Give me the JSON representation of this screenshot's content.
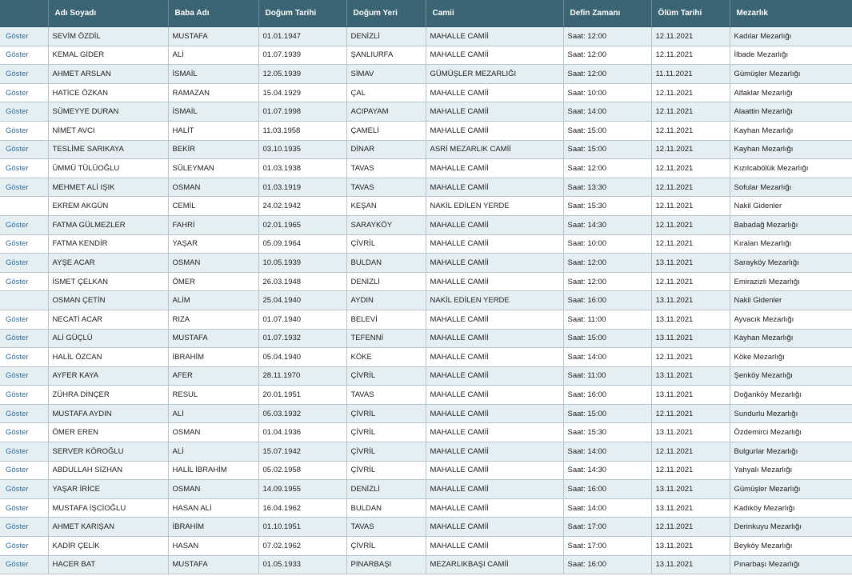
{
  "table": {
    "columns": [
      "",
      "Adı Soyadı",
      "Baba Adı",
      "Doğum Tarihi",
      "Doğum Yeri",
      "Camii",
      "Defin Zamanı",
      "Ölüm Tarihi",
      "Mezarlık"
    ],
    "rows": [
      {
        "action": "Göster",
        "name": "SEVİM ÖZDİL",
        "father": "MUSTAFA",
        "birth_date": "01.01.1947",
        "birth_place": "DENİZLİ",
        "mosque": "MAHALLE CAMİİ",
        "burial_time": "Saat: 12:00",
        "death_date": "12.11.2021",
        "cemetery": "Kadılar Mezarlığı"
      },
      {
        "action": "Göster",
        "name": "KEMAL GİDER",
        "father": "ALİ",
        "birth_date": "01.07.1939",
        "birth_place": "ŞANLIURFA",
        "mosque": "MAHALLE CAMİİ",
        "burial_time": "Saat: 12:00",
        "death_date": "12.11.2021",
        "cemetery": "İlbade Mezarlığı"
      },
      {
        "action": "Göster",
        "name": "AHMET ARSLAN",
        "father": "İSMAİL",
        "birth_date": "12.05.1939",
        "birth_place": "SİMAV",
        "mosque": "GÜMÜŞLER MEZARLIĞI",
        "burial_time": "Saat: 12:00",
        "death_date": "11.11.2021",
        "cemetery": "Gümüşler Mezarlığı"
      },
      {
        "action": "Göster",
        "name": "HATİCE ÖZKAN",
        "father": "RAMAZAN",
        "birth_date": "15.04.1929",
        "birth_place": "ÇAL",
        "mosque": "MAHALLE CAMİİ",
        "burial_time": "Saat: 10:00",
        "death_date": "12.11.2021",
        "cemetery": "Alfaklar Mezarlığı"
      },
      {
        "action": "Göster",
        "name": "SÜMEYYE DURAN",
        "father": "İSMAİL",
        "birth_date": "01.07.1998",
        "birth_place": "ACIPAYAM",
        "mosque": "MAHALLE CAMİİ",
        "burial_time": "Saat: 14:00",
        "death_date": "12.11.2021",
        "cemetery": "Alaattin Mezarlığı"
      },
      {
        "action": "Göster",
        "name": "NİMET AVCI",
        "father": "HALİT",
        "birth_date": "11.03.1958",
        "birth_place": "ÇAMELİ",
        "mosque": "MAHALLE CAMİİ",
        "burial_time": "Saat: 15:00",
        "death_date": "12.11.2021",
        "cemetery": "Kayhan Mezarlığı"
      },
      {
        "action": "Göster",
        "name": "TESLİME SARIKAYA",
        "father": "BEKİR",
        "birth_date": "03.10.1935",
        "birth_place": "DİNAR",
        "mosque": "ASRİ MEZARLIK CAMİİ",
        "burial_time": "Saat: 15:00",
        "death_date": "12.11.2021",
        "cemetery": "Kayhan Mezarlığı"
      },
      {
        "action": "Göster",
        "name": "ÜMMÜ TÜLÜOĞLU",
        "father": "SÜLEYMAN",
        "birth_date": "01.03.1938",
        "birth_place": "TAVAS",
        "mosque": "MAHALLE CAMİİ",
        "burial_time": "Saat: 12:00",
        "death_date": "12.11.2021",
        "cemetery": "Kızılcabölük Mezarlığı"
      },
      {
        "action": "Göster",
        "name": "MEHMET ALİ IŞIK",
        "father": "OSMAN",
        "birth_date": "01.03.1919",
        "birth_place": "TAVAS",
        "mosque": "MAHALLE CAMİİ",
        "burial_time": "Saat: 13:30",
        "death_date": "12.11.2021",
        "cemetery": "Sofular Mezarlığı"
      },
      {
        "action": "",
        "name": "EKREM AKGÜN",
        "father": "CEMİL",
        "birth_date": "24.02.1942",
        "birth_place": "KEŞAN",
        "mosque": "NAKİL EDİLEN YERDE",
        "burial_time": "Saat: 15:30",
        "death_date": "12.11.2021",
        "cemetery": "Nakil Gidenler"
      },
      {
        "action": "Göster",
        "name": "FATMA GÜLMEZLER",
        "father": "FAHRİ",
        "birth_date": "02.01.1965",
        "birth_place": "SARAYKÖY",
        "mosque": "MAHALLE CAMİİ",
        "burial_time": "Saat: 14:30",
        "death_date": "12.11.2021",
        "cemetery": "Babadağ Mezarlığı"
      },
      {
        "action": "Göster",
        "name": "FATMA KENDİR",
        "father": "YAŞAR",
        "birth_date": "05.09.1964",
        "birth_place": "ÇİVRİL",
        "mosque": "MAHALLE CAMİİ",
        "burial_time": "Saat: 10:00",
        "death_date": "12.11.2021",
        "cemetery": "Kıralan Mezarlığı"
      },
      {
        "action": "Göster",
        "name": "AYŞE ACAR",
        "father": "OSMAN",
        "birth_date": "10.05.1939",
        "birth_place": "BULDAN",
        "mosque": "MAHALLE CAMİİ",
        "burial_time": "Saat: 12:00",
        "death_date": "13.11.2021",
        "cemetery": "Sarayköy Mezarlığı"
      },
      {
        "action": "Göster",
        "name": "İSMET ÇELKAN",
        "father": "ÖMER",
        "birth_date": "26.03.1948",
        "birth_place": "DENİZLİ",
        "mosque": "MAHALLE CAMİİ",
        "burial_time": "Saat: 12:00",
        "death_date": "12.11.2021",
        "cemetery": "Emirazizli Mezarlığı"
      },
      {
        "action": "",
        "name": "OSMAN ÇETİN",
        "father": "ALİM",
        "birth_date": "25.04.1940",
        "birth_place": "AYDIN",
        "mosque": "NAKİL EDİLEN YERDE",
        "burial_time": "Saat: 16:00",
        "death_date": "13.11.2021",
        "cemetery": "Nakil Gidenler"
      },
      {
        "action": "Göster",
        "name": "NECATİ ACAR",
        "father": "RIZA",
        "birth_date": "01.07.1940",
        "birth_place": "BELEVİ",
        "mosque": "MAHALLE CAMİİ",
        "burial_time": "Saat: 11:00",
        "death_date": "13.11.2021",
        "cemetery": "Ayvacık Mezarlığı"
      },
      {
        "action": "Göster",
        "name": "ALİ GÜÇLÜ",
        "father": "MUSTAFA",
        "birth_date": "01.07.1932",
        "birth_place": "TEFENNİ",
        "mosque": "MAHALLE CAMİİ",
        "burial_time": "Saat: 15:00",
        "death_date": "13.11.2021",
        "cemetery": "Kayhan Mezarlığı"
      },
      {
        "action": "Göster",
        "name": "HALİL ÖZCAN",
        "father": "İBRAHİM",
        "birth_date": "05.04.1940",
        "birth_place": "KÖKE",
        "mosque": "MAHALLE CAMİİ",
        "burial_time": "Saat: 14:00",
        "death_date": "12.11.2021",
        "cemetery": "Köke Mezarlığı"
      },
      {
        "action": "Göster",
        "name": "AYFER KAYA",
        "father": "AFER",
        "birth_date": "28.11.1970",
        "birth_place": "ÇİVRİL",
        "mosque": "MAHALLE CAMİİ",
        "burial_time": "Saat: 11:00",
        "death_date": "13.11.2021",
        "cemetery": "Şenköy Mezarlığı"
      },
      {
        "action": "Göster",
        "name": "ZÜHRA DİNÇER",
        "father": "RESUL",
        "birth_date": "20.01.1951",
        "birth_place": "TAVAS",
        "mosque": "MAHALLE CAMİİ",
        "burial_time": "Saat: 16:00",
        "death_date": "13.11.2021",
        "cemetery": "Doğanköy Mezarlığı"
      },
      {
        "action": "Göster",
        "name": "MUSTAFA AYDIN",
        "father": "ALİ",
        "birth_date": "05.03.1932",
        "birth_place": "ÇİVRİL",
        "mosque": "MAHALLE CAMİİ",
        "burial_time": "Saat: 15:00",
        "death_date": "12.11.2021",
        "cemetery": "Sundurlu Mezarlığı"
      },
      {
        "action": "Göster",
        "name": "ÖMER EREN",
        "father": "OSMAN",
        "birth_date": "01.04.1936",
        "birth_place": "ÇİVRİL",
        "mosque": "MAHALLE CAMİİ",
        "burial_time": "Saat: 15:30",
        "death_date": "13.11.2021",
        "cemetery": "Özdemirci Mezarlığı"
      },
      {
        "action": "Göster",
        "name": "SERVER KÖROĞLU",
        "father": "ALİ",
        "birth_date": "15.07.1942",
        "birth_place": "ÇİVRİL",
        "mosque": "MAHALLE CAMİİ",
        "burial_time": "Saat: 14:00",
        "death_date": "12.11.2021",
        "cemetery": "Bulgurlar Mezarlığı"
      },
      {
        "action": "Göster",
        "name": "ABDULLAH SİZHAN",
        "father": "HALİL İBRAHİM",
        "birth_date": "05.02.1958",
        "birth_place": "ÇİVRİL",
        "mosque": "MAHALLE CAMİİ",
        "burial_time": "Saat: 14:30",
        "death_date": "12.11.2021",
        "cemetery": "Yahyalı Mezarlığı"
      },
      {
        "action": "Göster",
        "name": "YAŞAR İRİCE",
        "father": "OSMAN",
        "birth_date": "14.09.1955",
        "birth_place": "DENİZLİ",
        "mosque": "MAHALLE CAMİİ",
        "burial_time": "Saat: 16:00",
        "death_date": "13.11.2021",
        "cemetery": "Gümüşler Mezarlığı"
      },
      {
        "action": "Göster",
        "name": "MUSTAFA İŞCİOĞLU",
        "father": "HASAN ALİ",
        "birth_date": "16.04.1962",
        "birth_place": "BULDAN",
        "mosque": "MAHALLE CAMİİ",
        "burial_time": "Saat: 14:00",
        "death_date": "13.11.2021",
        "cemetery": "Kadıköy Mezarlığı"
      },
      {
        "action": "Göster",
        "name": "AHMET KARIŞAN",
        "father": "İBRAHİM",
        "birth_date": "01.10.1951",
        "birth_place": "TAVAS",
        "mosque": "MAHALLE CAMİİ",
        "burial_time": "Saat: 17:00",
        "death_date": "12.11.2021",
        "cemetery": "Derinkuyu Mezarlığı"
      },
      {
        "action": "Göster",
        "name": "KADİR ÇELİK",
        "father": "HASAN",
        "birth_date": "07.02.1962",
        "birth_place": "ÇİVRİL",
        "mosque": "MAHALLE CAMİİ",
        "burial_time": "Saat: 17:00",
        "death_date": "13.11.2021",
        "cemetery": "Beyköy Mezarlığı"
      },
      {
        "action": "Göster",
        "name": "HACER BAT",
        "father": "MUSTAFA",
        "birth_date": "01.05.1933",
        "birth_place": "PINARBAŞI",
        "mosque": "MEZARLIKBAŞI CAMİİ",
        "burial_time": "Saat: 16:00",
        "death_date": "13.11.2021",
        "cemetery": "Pınarbaşı Mezarlığı"
      }
    ]
  }
}
